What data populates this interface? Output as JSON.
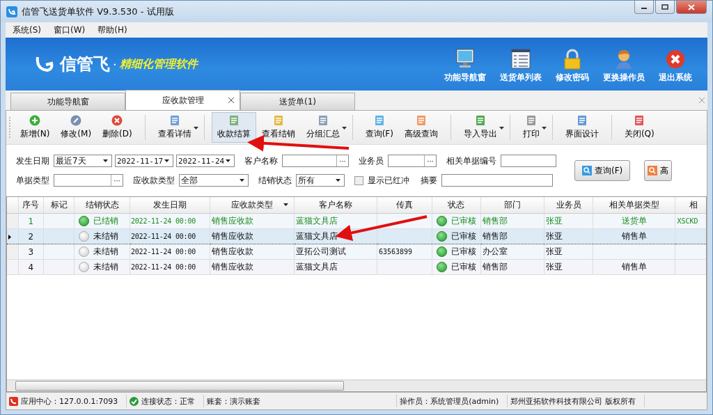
{
  "window": {
    "title": "信管飞送货单软件 V9.3.530 - 试用版"
  },
  "menu": [
    "系统(S)",
    "窗口(W)",
    "帮助(H)"
  ],
  "banner": {
    "logo": "信管飞",
    "dot": "·",
    "slogan": "精细化管理软件",
    "nav": [
      "功能导航窗",
      "送货单列表",
      "修改密码",
      "更换操作员",
      "退出系统"
    ]
  },
  "tabs": [
    {
      "label": "功能导航窗",
      "selected": false,
      "closable": false
    },
    {
      "label": "应收款管理",
      "selected": true,
      "closable": true
    },
    {
      "label": "送货单(1)",
      "selected": false,
      "closable": false
    }
  ],
  "toolbar": [
    {
      "label": "新增(N)",
      "dropdown": false,
      "selected": false
    },
    {
      "label": "修改(M)",
      "dropdown": false,
      "selected": false
    },
    {
      "label": "删除(D)",
      "dropdown": false,
      "selected": false
    },
    {
      "label": "查看详情",
      "dropdown": true,
      "selected": false
    },
    {
      "label": "收款结算",
      "dropdown": false,
      "selected": true
    },
    {
      "label": "查看结销",
      "dropdown": false,
      "selected": false
    },
    {
      "label": "分组汇总",
      "dropdown": true,
      "selected": false
    },
    {
      "label": "查询(F)",
      "dropdown": false,
      "selected": false
    },
    {
      "label": "高级查询",
      "dropdown": false,
      "selected": false
    },
    {
      "label": "导入导出",
      "dropdown": true,
      "selected": false
    },
    {
      "label": "打印",
      "dropdown": true,
      "selected": false
    },
    {
      "label": "界面设计",
      "dropdown": false,
      "selected": false
    },
    {
      "label": "关闭(Q)",
      "dropdown": false,
      "selected": false
    }
  ],
  "filters": {
    "date_label": "发生日期",
    "date_range": "最近7天",
    "date_from": "2022-11-17",
    "date_to": "2022-11-24",
    "customer_label": "客户名称",
    "customer_browse": "···",
    "salesman_browse": "···",
    "doc_type_browse": "···",
    "salesman_label": "业务员",
    "related_no_label": "相关单据编号",
    "doc_type_label": "单据类型",
    "receivable_type_label": "应收款类型",
    "receivable_type": "全部",
    "settle_label": "结销状态",
    "settle": "所有",
    "show_reversed": {
      "label": "显示已红冲",
      "checked": false
    },
    "summary_label": "摘要",
    "query_button": "查询(F)",
    "advanced_button": "高"
  },
  "table": {
    "columns": [
      "序号",
      "标记",
      "结销状态",
      "发生日期",
      "应收款类型",
      "客户名称",
      "传真",
      "状态",
      "部门",
      "业务员",
      "相关单据类型",
      "相"
    ],
    "rows": [
      {
        "no": "1",
        "settled": true,
        "selected": false,
        "settle_text": "已结销",
        "date": "2022-11-24 00:00",
        "type": "销售应收款",
        "customer": "蓝猫文具店",
        "fax": "",
        "status": "已审核",
        "dept": "销售部",
        "salesman": "张亚",
        "related_type": "送货单",
        "related_no": "XSCKD"
      },
      {
        "no": "2",
        "settled": false,
        "selected": true,
        "settle_text": "未结销",
        "date": "2022-11-24 00:00",
        "type": "销售应收款",
        "customer": "蓝猫文具店",
        "fax": "",
        "status": "已审核",
        "dept": "销售部",
        "salesman": "张亚",
        "related_type": "销售单",
        "related_no": ""
      },
      {
        "no": "3",
        "settled": false,
        "selected": false,
        "settle_text": "未结销",
        "date": "2022-11-24 00:00",
        "type": "销售应收款",
        "customer": "亚拓公司测试",
        "fax": "63563899",
        "status": "已审核",
        "dept": "办公室",
        "salesman": "张亚",
        "related_type": "",
        "related_no": ""
      },
      {
        "no": "4",
        "settled": false,
        "selected": false,
        "settle_text": "未结销",
        "date": "2022-11-24 00:00",
        "type": "销售应收款",
        "customer": "蓝猫文具店",
        "fax": "",
        "status": "已审核",
        "dept": "销售部",
        "salesman": "张亚",
        "related_type": "销售单",
        "related_no": ""
      }
    ]
  },
  "status_bar": {
    "app_center": "应用中心：127.0.0.1:7093",
    "connection": "连接状态：正常",
    "account": "账套：演示账套",
    "operator": "操作员：系统管理员(admin)",
    "copyright": "郑州亚拓软件科技有限公司 版权所有"
  }
}
